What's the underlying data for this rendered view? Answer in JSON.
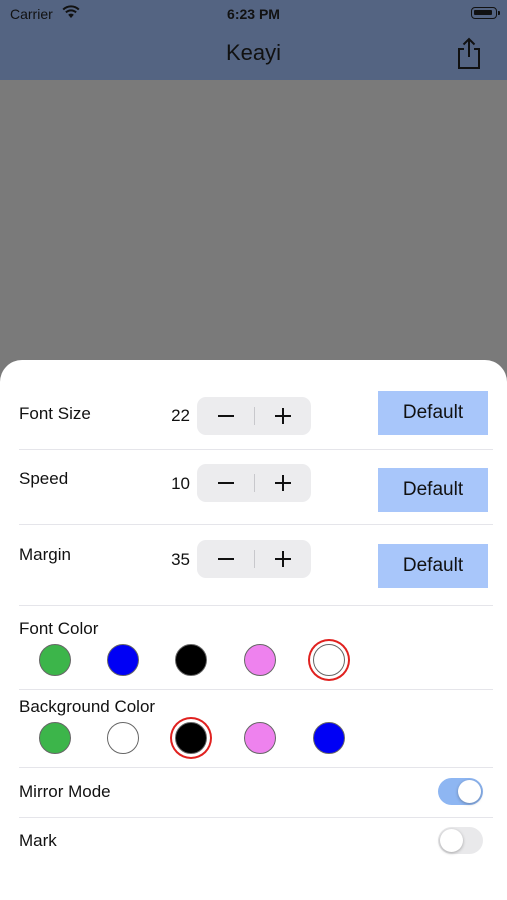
{
  "status": {
    "carrier": "Carrier",
    "time": "6:23 PM",
    "wifi_icon": "wifi-icon",
    "battery_icon": "battery-icon"
  },
  "nav": {
    "title": "Keayi",
    "share_icon": "share-icon"
  },
  "settings": {
    "font_size": {
      "label": "Font Size",
      "value": "22",
      "default_label": "Default"
    },
    "speed": {
      "label": "Speed",
      "value": "10",
      "default_label": "Default"
    },
    "margin": {
      "label": "Margin",
      "value": "35",
      "default_label": "Default"
    },
    "font_color": {
      "label": "Font Color",
      "swatches": [
        "#3cb54a",
        "#0000f5",
        "#000000",
        "#ee82ee",
        "#ffffff"
      ],
      "selected_index": 4
    },
    "background_color": {
      "label": "Background Color",
      "swatches": [
        "#3cb54a",
        "#ffffff",
        "#000000",
        "#ee82ee",
        "#0000f5"
      ],
      "selected_index": 2
    },
    "mirror_mode": {
      "label": "Mirror Mode",
      "on": true
    },
    "mark": {
      "label": "Mark",
      "on": false
    }
  },
  "colors": {
    "nav_background": "#546482",
    "dim_overlay": "#7a7a7a",
    "default_button": "#a8c6fa",
    "selected_ring": "#e0211f",
    "toggle_on": "#8eb6f2"
  }
}
